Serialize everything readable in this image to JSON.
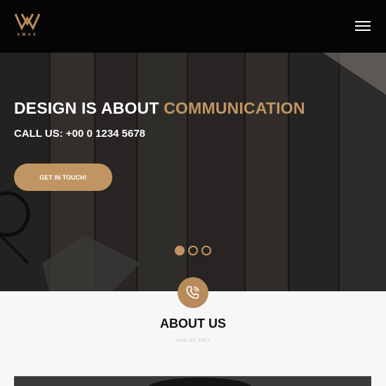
{
  "header": {
    "logo_text": "AWAX",
    "menu_icon": "hamburger-menu-icon"
  },
  "hero": {
    "title_main": "DESIGN IS ABOUT",
    "title_accent": "COMMUNICATION",
    "subtitle": "CALL US: +00 0 1234 5678",
    "cta_label": "GET IN TOUCH!",
    "slider": {
      "total": 3,
      "active": 1
    }
  },
  "about": {
    "icon": "phone-icon",
    "title": "ABOUT US",
    "subtitle": "WHO WE ARE?"
  },
  "colors": {
    "accent": "#c19562",
    "header_bg": "#050505",
    "page_bg": "#f7f7f7"
  }
}
